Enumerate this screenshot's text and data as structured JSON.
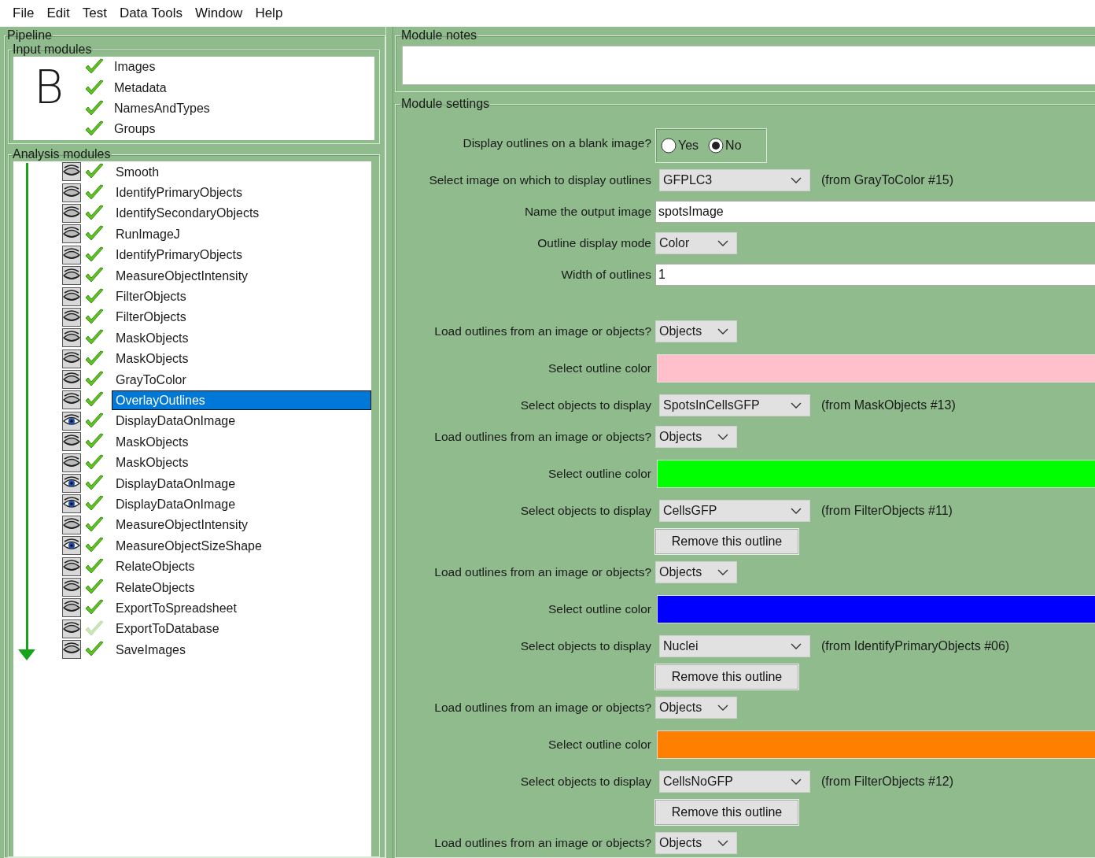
{
  "menu": [
    "File",
    "Edit",
    "Test",
    "Data Tools",
    "Window",
    "Help"
  ],
  "pipeline": {
    "title": "Pipeline",
    "input": {
      "title": "Input modules",
      "panel_letter": "B",
      "modules": [
        {
          "name": "Images",
          "enabled": true
        },
        {
          "name": "Metadata",
          "enabled": true
        },
        {
          "name": "NamesAndTypes",
          "enabled": true
        },
        {
          "name": "Groups",
          "enabled": true
        }
      ]
    },
    "analysis": {
      "title": "Analysis modules",
      "modules": [
        {
          "name": "Smooth",
          "display": false,
          "enabled": true,
          "selected": false
        },
        {
          "name": "IdentifyPrimaryObjects",
          "display": false,
          "enabled": true,
          "selected": false
        },
        {
          "name": "IdentifySecondaryObjects",
          "display": false,
          "enabled": true,
          "selected": false
        },
        {
          "name": "RunImageJ",
          "display": false,
          "enabled": true,
          "selected": false
        },
        {
          "name": "IdentifyPrimaryObjects",
          "display": false,
          "enabled": true,
          "selected": false
        },
        {
          "name": "MeasureObjectIntensity",
          "display": false,
          "enabled": true,
          "selected": false
        },
        {
          "name": "FilterObjects",
          "display": false,
          "enabled": true,
          "selected": false
        },
        {
          "name": "FilterObjects",
          "display": false,
          "enabled": true,
          "selected": false
        },
        {
          "name": "MaskObjects",
          "display": false,
          "enabled": true,
          "selected": false
        },
        {
          "name": "MaskObjects",
          "display": false,
          "enabled": true,
          "selected": false
        },
        {
          "name": "GrayToColor",
          "display": false,
          "enabled": true,
          "selected": false
        },
        {
          "name": "OverlayOutlines",
          "display": false,
          "enabled": true,
          "selected": true
        },
        {
          "name": "DisplayDataOnImage",
          "display": true,
          "enabled": true,
          "selected": false
        },
        {
          "name": "MaskObjects",
          "display": false,
          "enabled": true,
          "selected": false
        },
        {
          "name": "MaskObjects",
          "display": false,
          "enabled": true,
          "selected": false
        },
        {
          "name": "DisplayDataOnImage",
          "display": true,
          "enabled": true,
          "selected": false
        },
        {
          "name": "DisplayDataOnImage",
          "display": true,
          "enabled": true,
          "selected": false
        },
        {
          "name": "MeasureObjectIntensity",
          "display": false,
          "enabled": true,
          "selected": false
        },
        {
          "name": "MeasureObjectSizeShape",
          "display": true,
          "enabled": true,
          "selected": false
        },
        {
          "name": "RelateObjects",
          "display": false,
          "enabled": true,
          "selected": false
        },
        {
          "name": "RelateObjects",
          "display": false,
          "enabled": true,
          "selected": false
        },
        {
          "name": "ExportToSpreadsheet",
          "display": false,
          "enabled": true,
          "selected": false
        },
        {
          "name": "ExportToDatabase",
          "display": false,
          "enabled": false,
          "selected": false
        },
        {
          "name": "SaveImages",
          "display": false,
          "enabled": true,
          "selected": false
        }
      ]
    }
  },
  "notes": {
    "title": "Module notes"
  },
  "settings": {
    "title": "Module settings",
    "general": [
      {
        "kind": "radio",
        "label": "Display outlines on a blank image?",
        "options": [
          {
            "label": "Yes",
            "selected": false
          },
          {
            "label": "No",
            "selected": true
          }
        ]
      },
      {
        "kind": "dropdown",
        "label": "Select image on which to display outlines",
        "value": "GFPLC3",
        "note": "(from GrayToColor #15)"
      },
      {
        "kind": "text",
        "label": "Name the output image",
        "value": "spotsImage"
      },
      {
        "kind": "dropdown",
        "label": "Outline display mode",
        "value": "Color"
      },
      {
        "kind": "text",
        "label": "Width of outlines",
        "value": "1"
      }
    ],
    "outlines": [
      {
        "rows": [
          {
            "kind": "dropdown",
            "label": "Load outlines from an image or objects?",
            "value": "Objects"
          },
          {
            "kind": "color",
            "label": "Select outline color",
            "color": "#ffc0cb"
          },
          {
            "kind": "dropdown",
            "label": "Select objects to display",
            "value": "SpotsInCellsGFP",
            "note": "(from MaskObjects #13)"
          }
        ]
      },
      {
        "rows": [
          {
            "kind": "dropdown",
            "label": "Load outlines from an image or objects?",
            "value": "Objects"
          },
          {
            "kind": "color",
            "label": "Select outline color",
            "color": "#00ff00"
          },
          {
            "kind": "dropdown",
            "label": "Select objects to display",
            "value": "CellsGFP",
            "note": "(from FilterObjects #11)"
          },
          {
            "kind": "button",
            "text": "Remove this outline"
          }
        ]
      },
      {
        "rows": [
          {
            "kind": "dropdown",
            "label": "Load outlines from an image or objects?",
            "value": "Objects"
          },
          {
            "kind": "color",
            "label": "Select outline color",
            "color": "#0000ff"
          },
          {
            "kind": "dropdown",
            "label": "Select objects to display",
            "value": "Nuclei",
            "note": "(from IdentifyPrimaryObjects #06)"
          },
          {
            "kind": "button",
            "text": "Remove this outline"
          }
        ]
      },
      {
        "rows": [
          {
            "kind": "dropdown",
            "label": "Load outlines from an image or objects?",
            "value": "Objects"
          },
          {
            "kind": "color",
            "label": "Select outline color",
            "color": "#ff8000"
          },
          {
            "kind": "dropdown",
            "label": "Select objects to display",
            "value": "CellsNoGFP",
            "note": "(from FilterObjects #12)"
          },
          {
            "kind": "button",
            "text": "Remove this outline"
          }
        ]
      },
      {
        "rows": [
          {
            "kind": "dropdown",
            "label": "Load outlines from an image or objects?",
            "value": "Objects"
          }
        ]
      }
    ]
  }
}
